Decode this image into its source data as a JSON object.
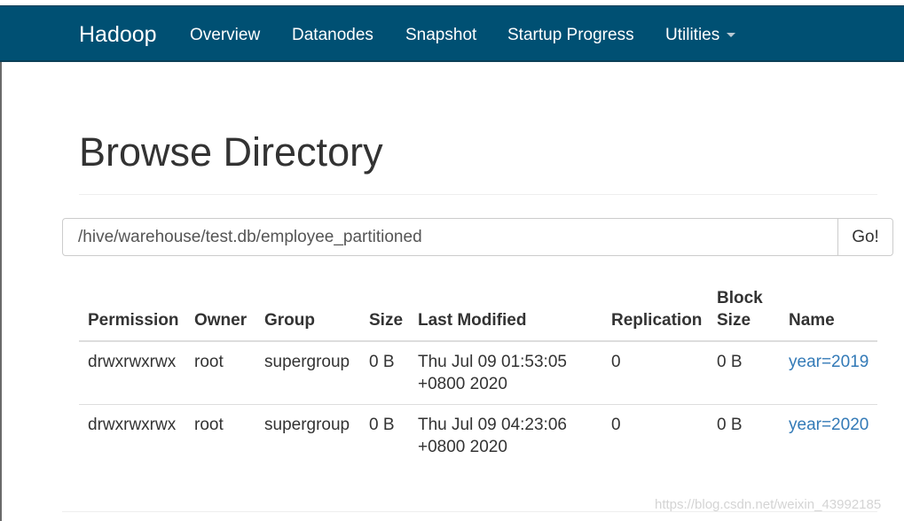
{
  "navbar": {
    "brand": "Hadoop",
    "items": [
      {
        "label": "Overview"
      },
      {
        "label": "Datanodes"
      },
      {
        "label": "Snapshot"
      },
      {
        "label": "Startup Progress"
      },
      {
        "label": "Utilities"
      }
    ]
  },
  "page": {
    "title": "Browse Directory"
  },
  "path_bar": {
    "value": "/hive/warehouse/test.db/employee_partitioned",
    "go_label": "Go!"
  },
  "table": {
    "headers": {
      "permission": "Permission",
      "owner": "Owner",
      "group": "Group",
      "size": "Size",
      "last_modified": "Last Modified",
      "replication": "Replication",
      "block_size_line1": "Block",
      "block_size_line2": "Size",
      "name": "Name"
    },
    "rows": [
      {
        "permission": "drwxrwxrwx",
        "owner": "root",
        "group": "supergroup",
        "size": "0 B",
        "last_modified_line1": "Thu Jul 09 01:53:05",
        "last_modified_line2": "+0800 2020",
        "replication": "0",
        "block_size": "0 B",
        "name": "year=2019"
      },
      {
        "permission": "drwxrwxrwx",
        "owner": "root",
        "group": "supergroup",
        "size": "0 B",
        "last_modified_line1": "Thu Jul 09 04:23:06",
        "last_modified_line2": "+0800 2020",
        "replication": "0",
        "block_size": "0 B",
        "name": "year=2020"
      }
    ]
  },
  "watermark": "https://blog.csdn.net/weixin_43992185"
}
